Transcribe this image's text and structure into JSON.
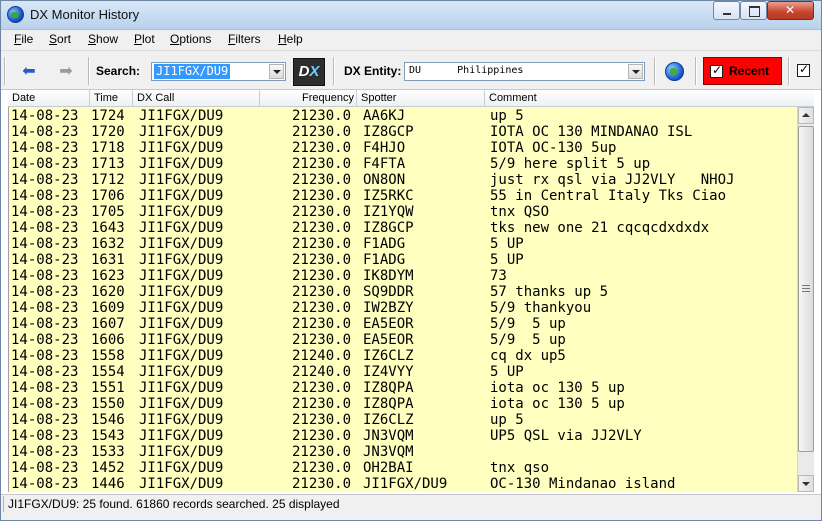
{
  "window": {
    "title": "DX Monitor History"
  },
  "menu": [
    "File",
    "Sort",
    "Show",
    "Plot",
    "Options",
    "Filters",
    "Help"
  ],
  "toolbar": {
    "search_label": "Search:",
    "search_value": "JI1FGX/DU9",
    "entity_label": "DX Entity:",
    "entity_value": "DU      Philippines",
    "recent_label": "Recent",
    "recent_checked": true,
    "extra_checkbox_checked": true
  },
  "columns": [
    "Date",
    "Time",
    "DX Call",
    "Frequency",
    "Spotter",
    "Comment"
  ],
  "rows": [
    [
      "14-08-23",
      "1724",
      "JI1FGX/DU9",
      "21230.0",
      "AA6KJ",
      "up 5"
    ],
    [
      "14-08-23",
      "1720",
      "JI1FGX/DU9",
      "21230.0",
      "IZ8GCP",
      "IOTA OC 130 MINDANAO ISL"
    ],
    [
      "14-08-23",
      "1718",
      "JI1FGX/DU9",
      "21230.0",
      "F4HJO",
      "IOTA OC-130 5up"
    ],
    [
      "14-08-23",
      "1713",
      "JI1FGX/DU9",
      "21230.0",
      "F4FTA",
      "5/9 here split 5 up"
    ],
    [
      "14-08-23",
      "1712",
      "JI1FGX/DU9",
      "21230.0",
      "ON8ON",
      "just rx qsl via JJ2VLY   NHOJ"
    ],
    [
      "14-08-23",
      "1706",
      "JI1FGX/DU9",
      "21230.0",
      "IZ5RKC",
      "55 in Central Italy Tks Ciao"
    ],
    [
      "14-08-23",
      "1705",
      "JI1FGX/DU9",
      "21230.0",
      "IZ1YQW",
      "tnx QSO"
    ],
    [
      "14-08-23",
      "1643",
      "JI1FGX/DU9",
      "21230.0",
      "IZ8GCP",
      "tks new one 21 cqcqcdxdxdx"
    ],
    [
      "14-08-23",
      "1632",
      "JI1FGX/DU9",
      "21230.0",
      "F1ADG",
      "5 UP"
    ],
    [
      "14-08-23",
      "1631",
      "JI1FGX/DU9",
      "21230.0",
      "F1ADG",
      "5 UP"
    ],
    [
      "14-08-23",
      "1623",
      "JI1FGX/DU9",
      "21230.0",
      "IK8DYM",
      "73"
    ],
    [
      "14-08-23",
      "1620",
      "JI1FGX/DU9",
      "21230.0",
      "SQ9DDR",
      "57 thanks up 5"
    ],
    [
      "14-08-23",
      "1609",
      "JI1FGX/DU9",
      "21230.0",
      "IW2BZY",
      "5/9 thankyou"
    ],
    [
      "14-08-23",
      "1607",
      "JI1FGX/DU9",
      "21230.0",
      "EA5EOR",
      "5/9  5 up"
    ],
    [
      "14-08-23",
      "1606",
      "JI1FGX/DU9",
      "21230.0",
      "EA5EOR",
      "5/9  5 up"
    ],
    [
      "14-08-23",
      "1558",
      "JI1FGX/DU9",
      "21240.0",
      "IZ6CLZ",
      "cq dx up5"
    ],
    [
      "14-08-23",
      "1554",
      "JI1FGX/DU9",
      "21240.0",
      "IZ4VYY",
      "5 UP"
    ],
    [
      "14-08-23",
      "1551",
      "JI1FGX/DU9",
      "21230.0",
      "IZ8QPA",
      "iota oc 130 5 up"
    ],
    [
      "14-08-23",
      "1550",
      "JI1FGX/DU9",
      "21230.0",
      "IZ8QPA",
      "iota oc 130 5 up"
    ],
    [
      "14-08-23",
      "1546",
      "JI1FGX/DU9",
      "21230.0",
      "IZ6CLZ",
      "up 5"
    ],
    [
      "14-08-23",
      "1543",
      "JI1FGX/DU9",
      "21230.0",
      "JN3VQM",
      "UP5 QSL via JJ2VLY"
    ],
    [
      "14-08-23",
      "1533",
      "JI1FGX/DU9",
      "21230.0",
      "JN3VQM",
      ""
    ],
    [
      "14-08-23",
      "1452",
      "JI1FGX/DU9",
      "21230.0",
      "OH2BAI",
      "tnx qso"
    ],
    [
      "14-08-23",
      "1446",
      "JI1FGX/DU9",
      "21230.0",
      "JI1FGX/DU9",
      "OC-130 Mindanao island"
    ]
  ],
  "status": {
    "text": "JI1FGX/DU9: 25 found.  61860 records searched.  25 displayed"
  },
  "colors": {
    "list_background": "#ffffc0",
    "recent_button": "#ff0000",
    "selection": "#3399ff"
  }
}
